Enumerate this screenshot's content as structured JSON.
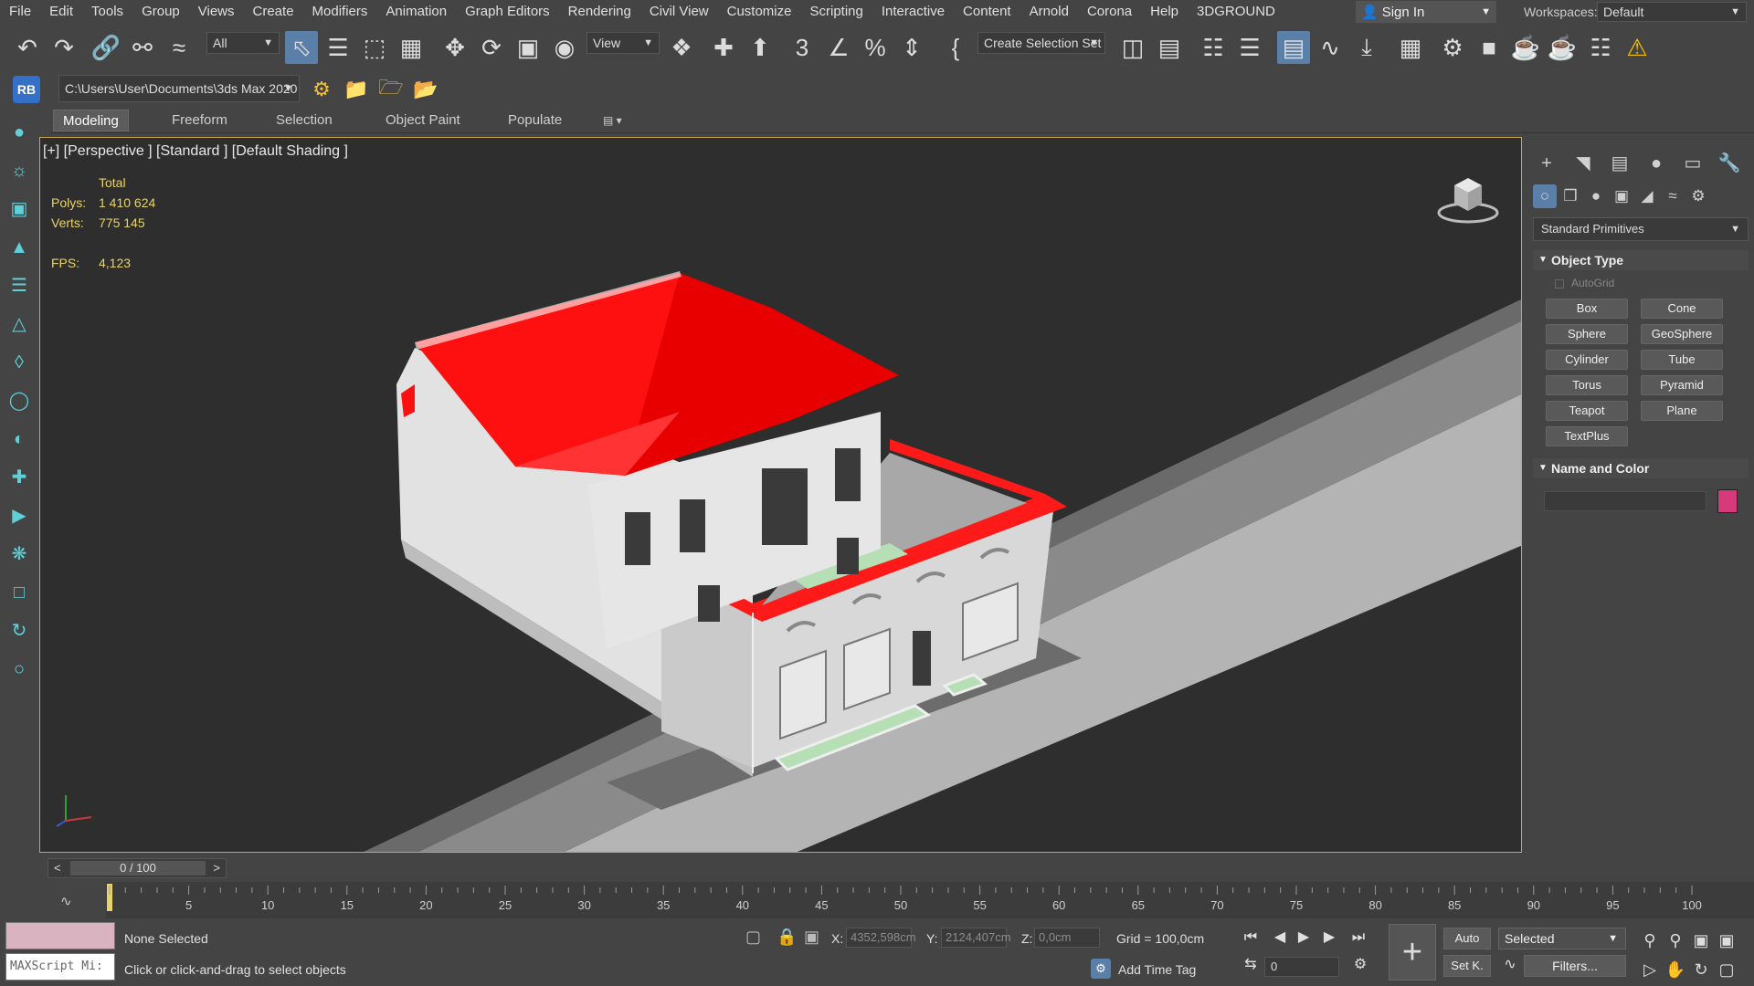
{
  "menu": [
    "File",
    "Edit",
    "Tools",
    "Group",
    "Views",
    "Create",
    "Modifiers",
    "Animation",
    "Graph Editors",
    "Rendering",
    "Civil View",
    "Customize",
    "Scripting",
    "Interactive",
    "Content",
    "Arnold",
    "Corona",
    "Help",
    "3DGROUND"
  ],
  "account": {
    "sign_in": "Sign In"
  },
  "workspaces": {
    "label": "Workspaces:",
    "value": "Default"
  },
  "toolbar": {
    "filter_select": "All",
    "ref_coord_select": "View",
    "selection_set": "Create Selection Set"
  },
  "project": {
    "badge": "RB",
    "path": "C:\\Users\\User\\Documents\\3ds Max 2020"
  },
  "ribbon": {
    "tabs": [
      "Modeling",
      "Freeform",
      "Selection",
      "Object Paint",
      "Populate"
    ],
    "active": "Modeling"
  },
  "viewport": {
    "label": "[+] [Perspective ] [Standard ] [Default Shading ]",
    "stats": {
      "header": "Total",
      "polys_label": "Polys:",
      "polys": "1 410 624",
      "verts_label": "Verts:",
      "verts": "775 145",
      "fps_label": "FPS:",
      "fps": "4,123"
    },
    "colors": {
      "roof": "#ff1010",
      "walls": "#dcdcdc",
      "ground": "#3a3a3a",
      "lawn": "#b6dfb6",
      "background": "#2e2e2e"
    }
  },
  "command_panel": {
    "category": "Standard Primitives",
    "object_type": {
      "title": "Object Type",
      "autogrid": "AutoGrid",
      "buttons": [
        "Box",
        "Cone",
        "Sphere",
        "GeoSphere",
        "Cylinder",
        "Tube",
        "Torus",
        "Pyramid",
        "Teapot",
        "Plane",
        "TextPlus"
      ]
    },
    "name_color": {
      "title": "Name and Color",
      "swatch_color": "#d63a7a"
    }
  },
  "timeline": {
    "slider": "0 / 100",
    "ticks": [
      "5",
      "10",
      "15",
      "20",
      "25",
      "30",
      "35",
      "40",
      "45",
      "50",
      "55",
      "60",
      "65",
      "70",
      "75",
      "80",
      "85",
      "90",
      "95",
      "100"
    ]
  },
  "status": {
    "maxscript": "MAXScript Mi:",
    "selection": "None Selected",
    "prompt": "Click or click-and-drag to select objects",
    "x_label": "X:",
    "x": "4352,598cm",
    "y_label": "Y:",
    "y": "2124,407cm",
    "z_label": "Z:",
    "z": "0,0cm",
    "grid": "Grid = 100,0cm",
    "add_time_tag": "Add Time Tag",
    "frame": "0",
    "auto": "Auto",
    "set_key": "Set K.",
    "key_filter": "Selected",
    "filters": "Filters..."
  }
}
